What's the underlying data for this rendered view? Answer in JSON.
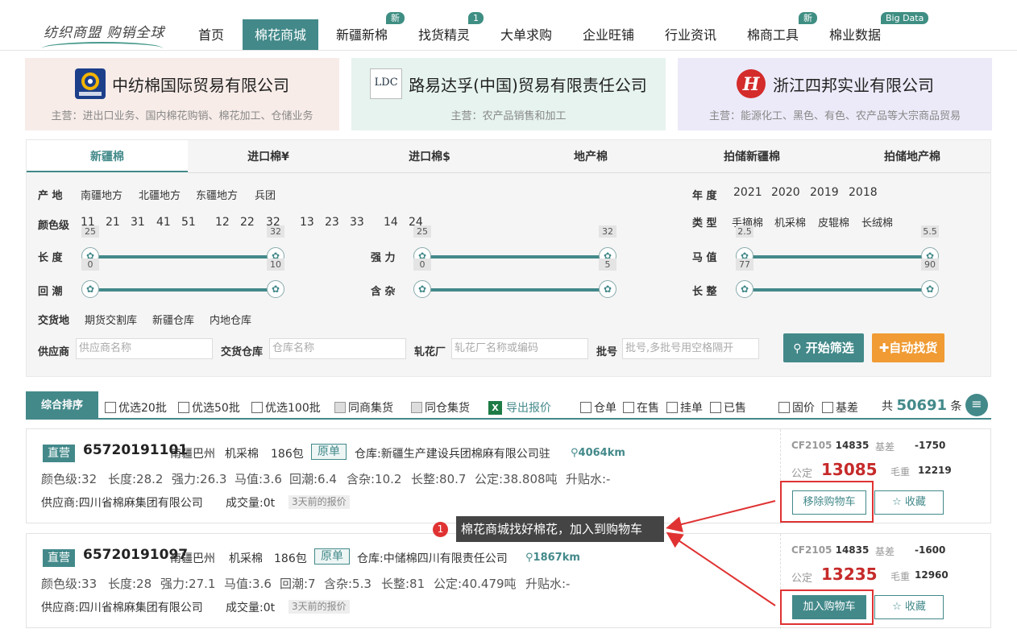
{
  "header": {
    "logo": "纺织商盟  购销全球",
    "nav": [
      {
        "label": "首页",
        "badge": ""
      },
      {
        "label": "棉花商城",
        "badge": ""
      },
      {
        "label": "新疆新棉",
        "badge": "新"
      },
      {
        "label": "找货精灵",
        "badge": "1"
      },
      {
        "label": "大单求购",
        "badge": ""
      },
      {
        "label": "企业旺铺",
        "badge": ""
      },
      {
        "label": "行业资讯",
        "badge": ""
      },
      {
        "label": "棉商工具",
        "badge": "新"
      },
      {
        "label": "棉业数据",
        "badge": "Big Data"
      }
    ]
  },
  "ads": [
    {
      "name": "中纺棉国际贸易有限公司",
      "sub": "主营：进出口业务、国内棉花购销、棉花加工、仓储业务"
    },
    {
      "name": "路易达孚(中国)贸易有限责任公司",
      "sub": "主营：农产品销售和加工",
      "logo_text": "LDC"
    },
    {
      "name": "浙江四邦实业有限公司",
      "sub": "主营：能源化工、黑色、有色、农产品等大宗商品贸易"
    }
  ],
  "tabs": [
    "新疆棉",
    "进口棉¥",
    "进口棉$",
    "地产棉",
    "拍储新疆棉",
    "拍储地产棉"
  ],
  "filters": {
    "origin_label": "产 地",
    "origin": [
      "南疆地方",
      "北疆地方",
      "东疆地方",
      "兵团"
    ],
    "year_label": "年 度",
    "years": [
      "2021",
      "2020",
      "2019",
      "2018"
    ],
    "color_label": "颜色级",
    "colors": [
      "11",
      "21",
      "31",
      "41",
      "51",
      "12",
      "22",
      "32",
      "13",
      "23",
      "33",
      "14",
      "24"
    ],
    "type_label": "类 型",
    "types": [
      "手摘棉",
      "机采棉",
      "皮辊棉",
      "长绒棉"
    ],
    "sliders": [
      {
        "label": "长 度",
        "min": "25",
        "max": "32"
      },
      {
        "label": "强 力",
        "min": "25",
        "max": "32"
      },
      {
        "label": "马 值",
        "min": "2.5",
        "max": "5.5"
      },
      {
        "label": "回 潮",
        "min": "0",
        "max": "10"
      },
      {
        "label": "含 杂",
        "min": "0",
        "max": "5"
      },
      {
        "label": "长 整",
        "min": "77",
        "max": "90"
      }
    ],
    "delivery_label": "交货地",
    "delivery": [
      "期货交割库",
      "新疆仓库",
      "内地仓库"
    ],
    "supplier_label": "供应商",
    "supplier_ph": "供应商名称",
    "warehouse_label": "交货仓库",
    "warehouse_ph": "仓库名称",
    "gin_label": "轧花厂",
    "gin_ph": "轧花厂名称或编码",
    "batch_label": "批号",
    "batch_ph": "批号,多批号用空格隔开",
    "search_btn": "开始筛选",
    "auto_btn": "自动找货"
  },
  "sortbar": {
    "main": "综合排序",
    "checks": [
      "优选20批",
      "优选50批",
      "优选100批",
      "同商集货",
      "同仓集货"
    ],
    "export": "导出报价",
    "checks2": [
      "仓单",
      "在售",
      "挂单",
      "已售"
    ],
    "checks3": [
      "固价",
      "基差"
    ],
    "total_prefix": "共",
    "total": "50691",
    "total_suffix": "条"
  },
  "listings": [
    {
      "tag": "直营",
      "batch": "65720191101",
      "region": "南疆巴州",
      "kind": "机采棉",
      "bales": "186包",
      "raw": "原单",
      "warehouse": "仓库:新疆生产建设兵团棉麻有限公司驻",
      "distance": "4064km",
      "specs": [
        "颜色级:32",
        "长度:28.2",
        "强力:26.3",
        "马值:3.6",
        "回潮:6.4",
        "含杂:10.2",
        "长整:80.7",
        "公定:38.808吨",
        "升贴水:-"
      ],
      "supplier": "供应商:四川省棉麻集团有限公司",
      "volume": "成交量:0t",
      "time": "3天前的报价",
      "contract": "CF2105",
      "contract_price": "14835",
      "basis_label": "基差",
      "basis": "-1750",
      "fixed_label": "公定",
      "price": "13085",
      "gross_label": "毛重",
      "gross": "12219",
      "cart_btn": "移除购物车",
      "fav_btn": "收藏"
    },
    {
      "tag": "直营",
      "batch": "65720191097",
      "region": "南疆巴州",
      "kind": "机采棉",
      "bales": "186包",
      "raw": "原单",
      "warehouse": "仓库:中储棉四川有限责任公司",
      "distance": "1867km",
      "specs": [
        "颜色级:33",
        "长度:28",
        "强力:27.1",
        "马值:3.6",
        "回潮:7",
        "含杂:5.3",
        "长整:81",
        "公定:40.479吨",
        "升贴水:-"
      ],
      "supplier": "供应商:四川省棉麻集团有限公司",
      "volume": "成交量:0t",
      "time": "3天前的报价",
      "contract": "CF2105",
      "contract_price": "14835",
      "basis_label": "基差",
      "basis": "-1600",
      "fixed_label": "公定",
      "price": "13235",
      "gross_label": "毛重",
      "gross": "12960",
      "cart_btn": "加入购物车",
      "fav_btn": "收藏"
    }
  ],
  "callout": {
    "num": "1",
    "text": "棉花商城找好棉花，加入到购物车"
  }
}
